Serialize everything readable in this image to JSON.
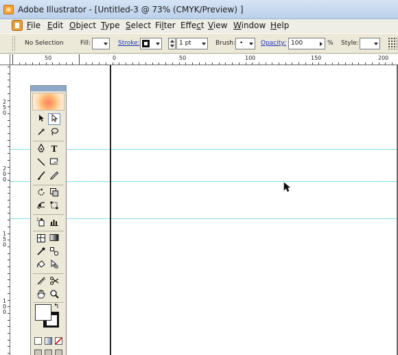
{
  "window": {
    "title": "Adobe Illustrator - [Untitled-3 @ 73% (CMYK/Preview) ]"
  },
  "menu": [
    {
      "name": "menu-file",
      "mnemonic": "F",
      "rest": "ile"
    },
    {
      "name": "menu-edit",
      "mnemonic": "E",
      "rest": "dit"
    },
    {
      "name": "menu-object",
      "mnemonic": "O",
      "rest": "bject"
    },
    {
      "name": "menu-type",
      "mnemonic": "T",
      "rest": "ype"
    },
    {
      "name": "menu-select",
      "mnemonic": "S",
      "rest": "elect"
    },
    {
      "name": "menu-filter",
      "pre": "Fi",
      "mnemonic": "l",
      "rest": "ter"
    },
    {
      "name": "menu-effect",
      "pre": "Effe",
      "mnemonic": "c",
      "rest": "t"
    },
    {
      "name": "menu-view",
      "mnemonic": "V",
      "rest": "iew"
    },
    {
      "name": "menu-window",
      "mnemonic": "W",
      "rest": "indow"
    },
    {
      "name": "menu-help",
      "mnemonic": "H",
      "rest": "elp"
    }
  ],
  "control": {
    "selection": "No Selection",
    "fill_label": "Fill:",
    "stroke_label": "Stroke:",
    "stroke_weight": "1 pt",
    "brush_label": "Brush:",
    "brush_value": "•",
    "opacity_label": "Opacity:",
    "opacity_value": "100",
    "opacity_unit": "%",
    "style_label": "Style:"
  },
  "rulers": {
    "top_numbers": [
      "50",
      "0",
      "50",
      "100",
      "150",
      "200"
    ],
    "left_numbers": [
      [
        "2",
        "5",
        "0"
      ],
      [
        "2",
        "0",
        "0"
      ],
      [
        "1",
        "5",
        "0"
      ],
      [
        "1",
        "0",
        "0"
      ]
    ]
  },
  "tools": {
    "type_glyph": "T",
    "swap_glyph": "↰"
  },
  "colors": {
    "guide": "#7fe0e0",
    "title_bar": "#c8d9ef",
    "ui_face": "#ece9d8",
    "link_blue": "#1a35b5"
  }
}
